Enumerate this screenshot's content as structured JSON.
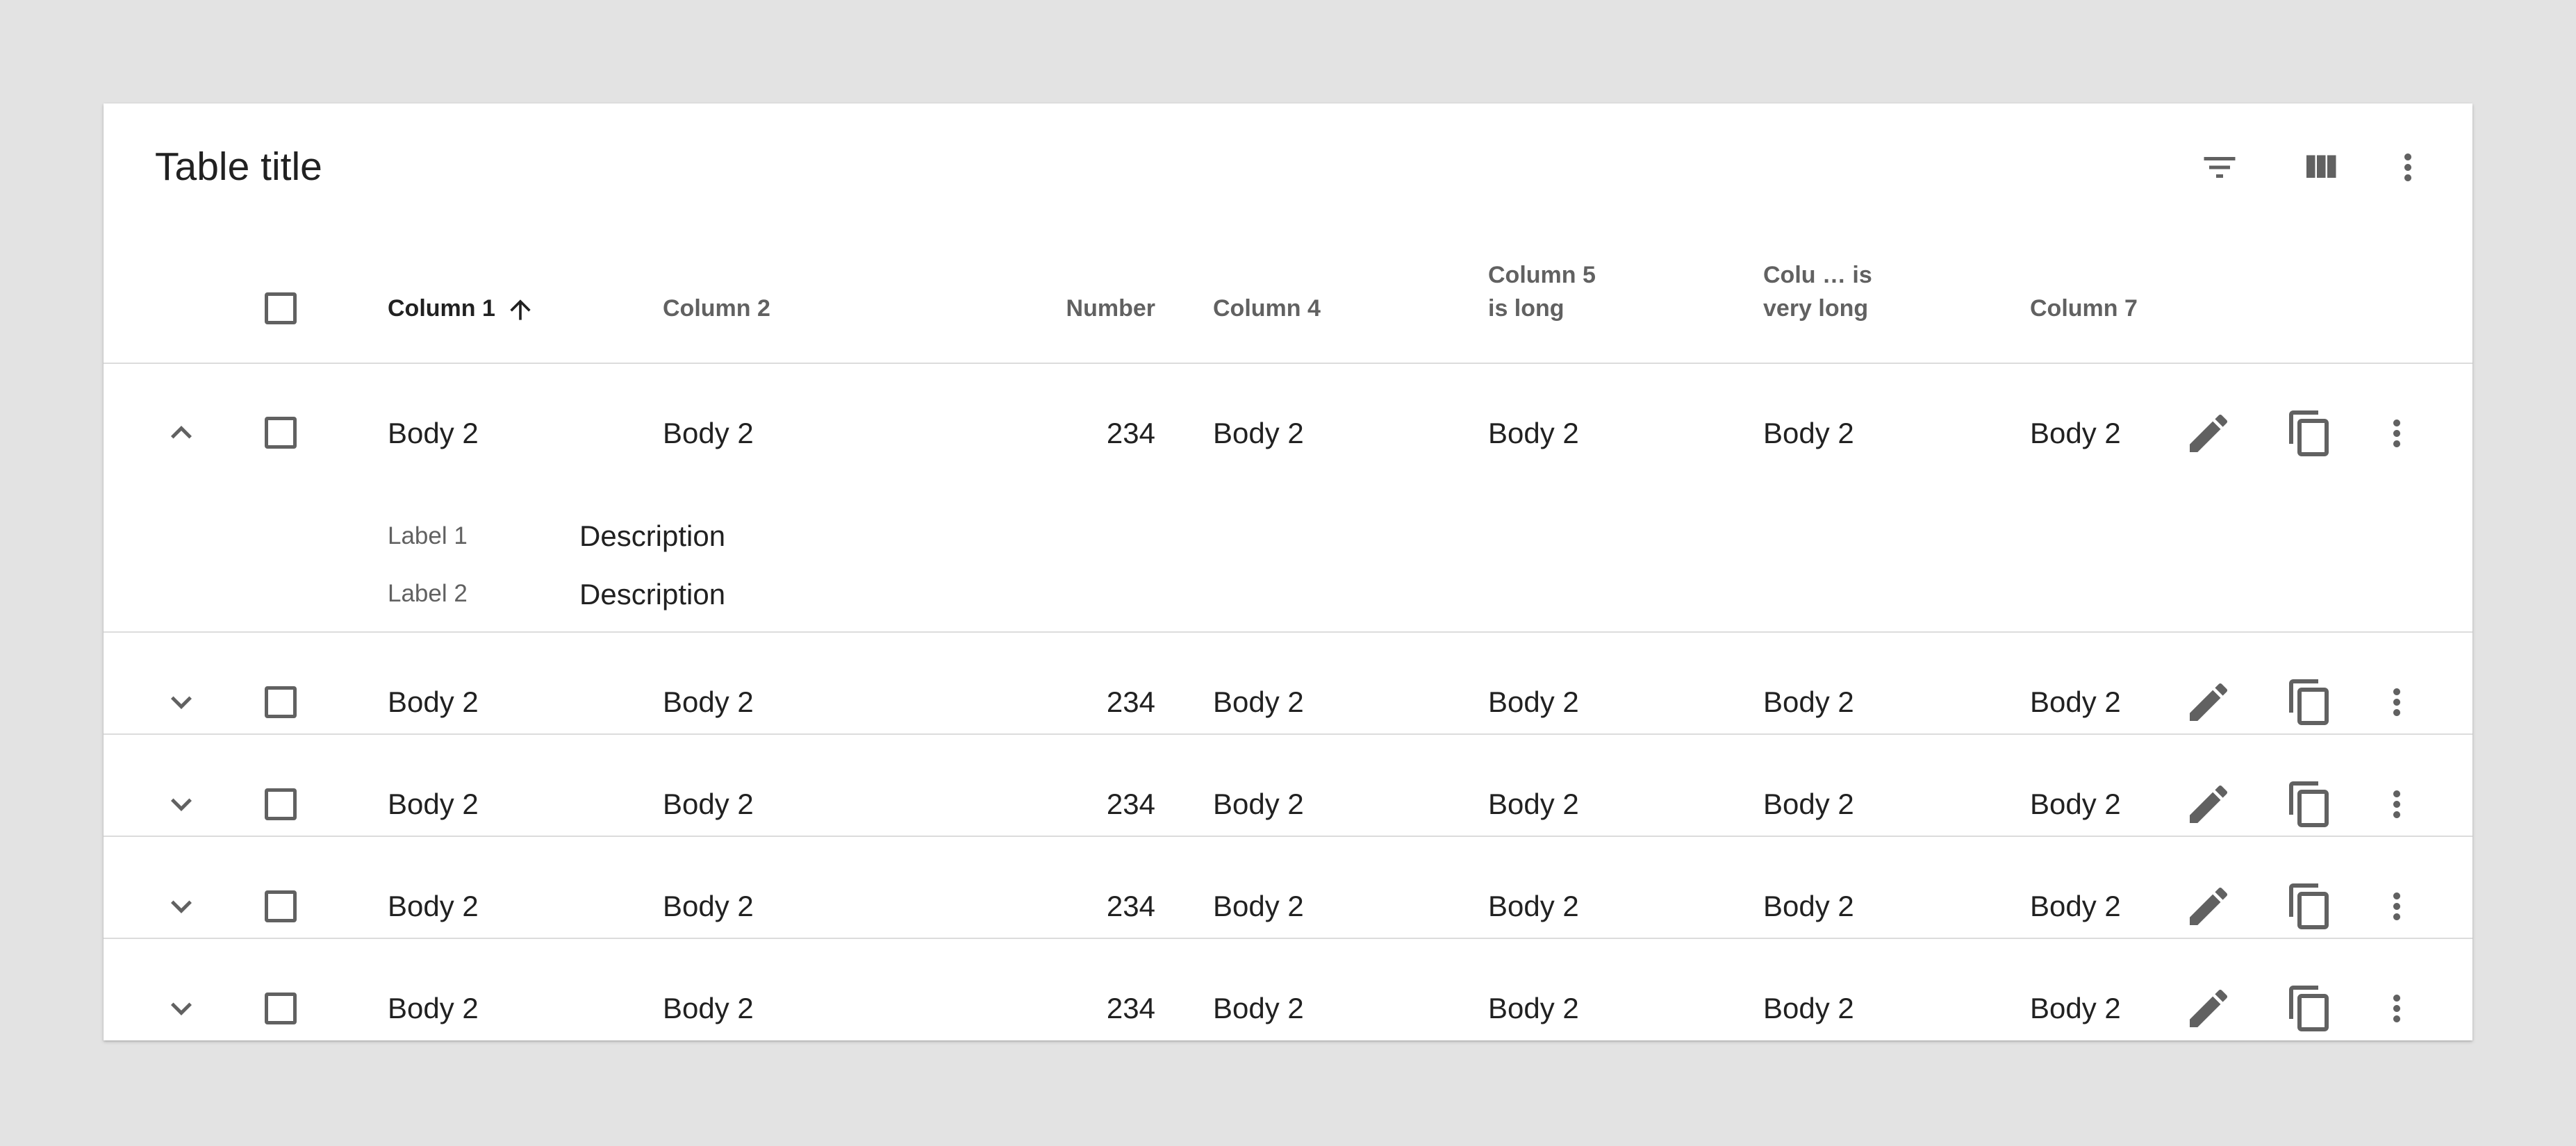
{
  "table": {
    "title": "Table title",
    "toolbar_icons": [
      "filter-icon",
      "view-column-icon",
      "more-vert-icon"
    ],
    "columns": [
      {
        "label": "Column 1",
        "sorted": "ascending"
      },
      {
        "label": "Column 2"
      },
      {
        "label": "Number"
      },
      {
        "label": "Column 4"
      },
      {
        "label": "Column 5 is long",
        "line1": "Column 5",
        "line2": "is long"
      },
      {
        "label": "Colu … is very long",
        "line1": "Colu … is",
        "line2": "very long"
      },
      {
        "label": "Column 7"
      }
    ],
    "rows": [
      {
        "expanded": true,
        "cells": [
          "Body 2",
          "Body 2",
          "234",
          "Body 2",
          "Body 2",
          "Body 2",
          "Body 2"
        ]
      },
      {
        "expanded": false,
        "cells": [
          "Body 2",
          "Body 2",
          "234",
          "Body 2",
          "Body 2",
          "Body 2",
          "Body 2"
        ]
      },
      {
        "expanded": false,
        "cells": [
          "Body 2",
          "Body 2",
          "234",
          "Body 2",
          "Body 2",
          "Body 2",
          "Body 2"
        ]
      },
      {
        "expanded": false,
        "cells": [
          "Body 2",
          "Body 2",
          "234",
          "Body 2",
          "Body 2",
          "Body 2",
          "Body 2"
        ]
      },
      {
        "expanded": false,
        "cells": [
          "Body 2",
          "Body 2",
          "234",
          "Body 2",
          "Body 2",
          "Body 2",
          "Body 2"
        ]
      }
    ],
    "expanded_details": [
      {
        "label": "Label 1",
        "description": "Description"
      },
      {
        "label": "Label 2",
        "description": "Description"
      }
    ],
    "row_action_icons": [
      "edit-icon",
      "copy-icon",
      "more-vert-icon"
    ]
  },
  "colors": {
    "background": "#e3e3e3",
    "surface": "#ffffff",
    "icon": "#616161",
    "text_primary": "#212121",
    "text_secondary": "#616161",
    "divider": "#dcdcdc"
  }
}
